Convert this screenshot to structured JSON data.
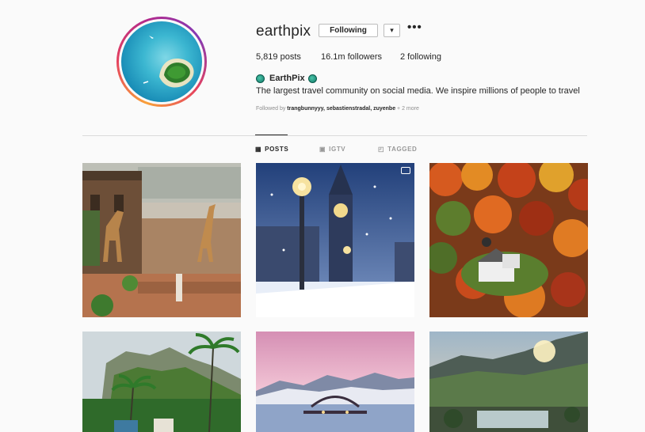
{
  "profile": {
    "username": "earthpix",
    "following_button": "Following",
    "dropdown_glyph": "▾",
    "more_glyph": "•••",
    "stats": {
      "posts": "5,819 posts",
      "followers": "16.1m followers",
      "following": "2 following"
    },
    "full_name": "EarthPix",
    "bio": "The largest travel community on social media. We inspire millions of people to travel",
    "followed_by": {
      "prefix": "Followed by ",
      "names": "trangbunnyyy, sebastienstradal, zuyenbe",
      "suffix": " + 2 more"
    }
  },
  "tabs": [
    {
      "label": "POSTS",
      "icon": "grid-icon",
      "glyph": "▦",
      "active": true
    },
    {
      "label": "IGTV",
      "icon": "igtv-icon",
      "glyph": "▣",
      "active": false
    },
    {
      "label": "TAGGED",
      "icon": "tag-icon",
      "glyph": "◰",
      "active": false
    }
  ],
  "posts": [
    {
      "subject": "giraffes at manor house",
      "video": false
    },
    {
      "subject": "big ben in snow",
      "video": true
    },
    {
      "subject": "autumn forest with house",
      "video": false
    },
    {
      "subject": "tropical cliffs and palms",
      "video": false
    },
    {
      "subject": "pink sunset over lagoon",
      "video": false
    },
    {
      "subject": "mountain valley sunrise pool",
      "video": false
    }
  ],
  "colors": {
    "text": "#262626",
    "muted": "#8e8e8e",
    "border": "#dbdbdb",
    "background": "#fafafa"
  }
}
